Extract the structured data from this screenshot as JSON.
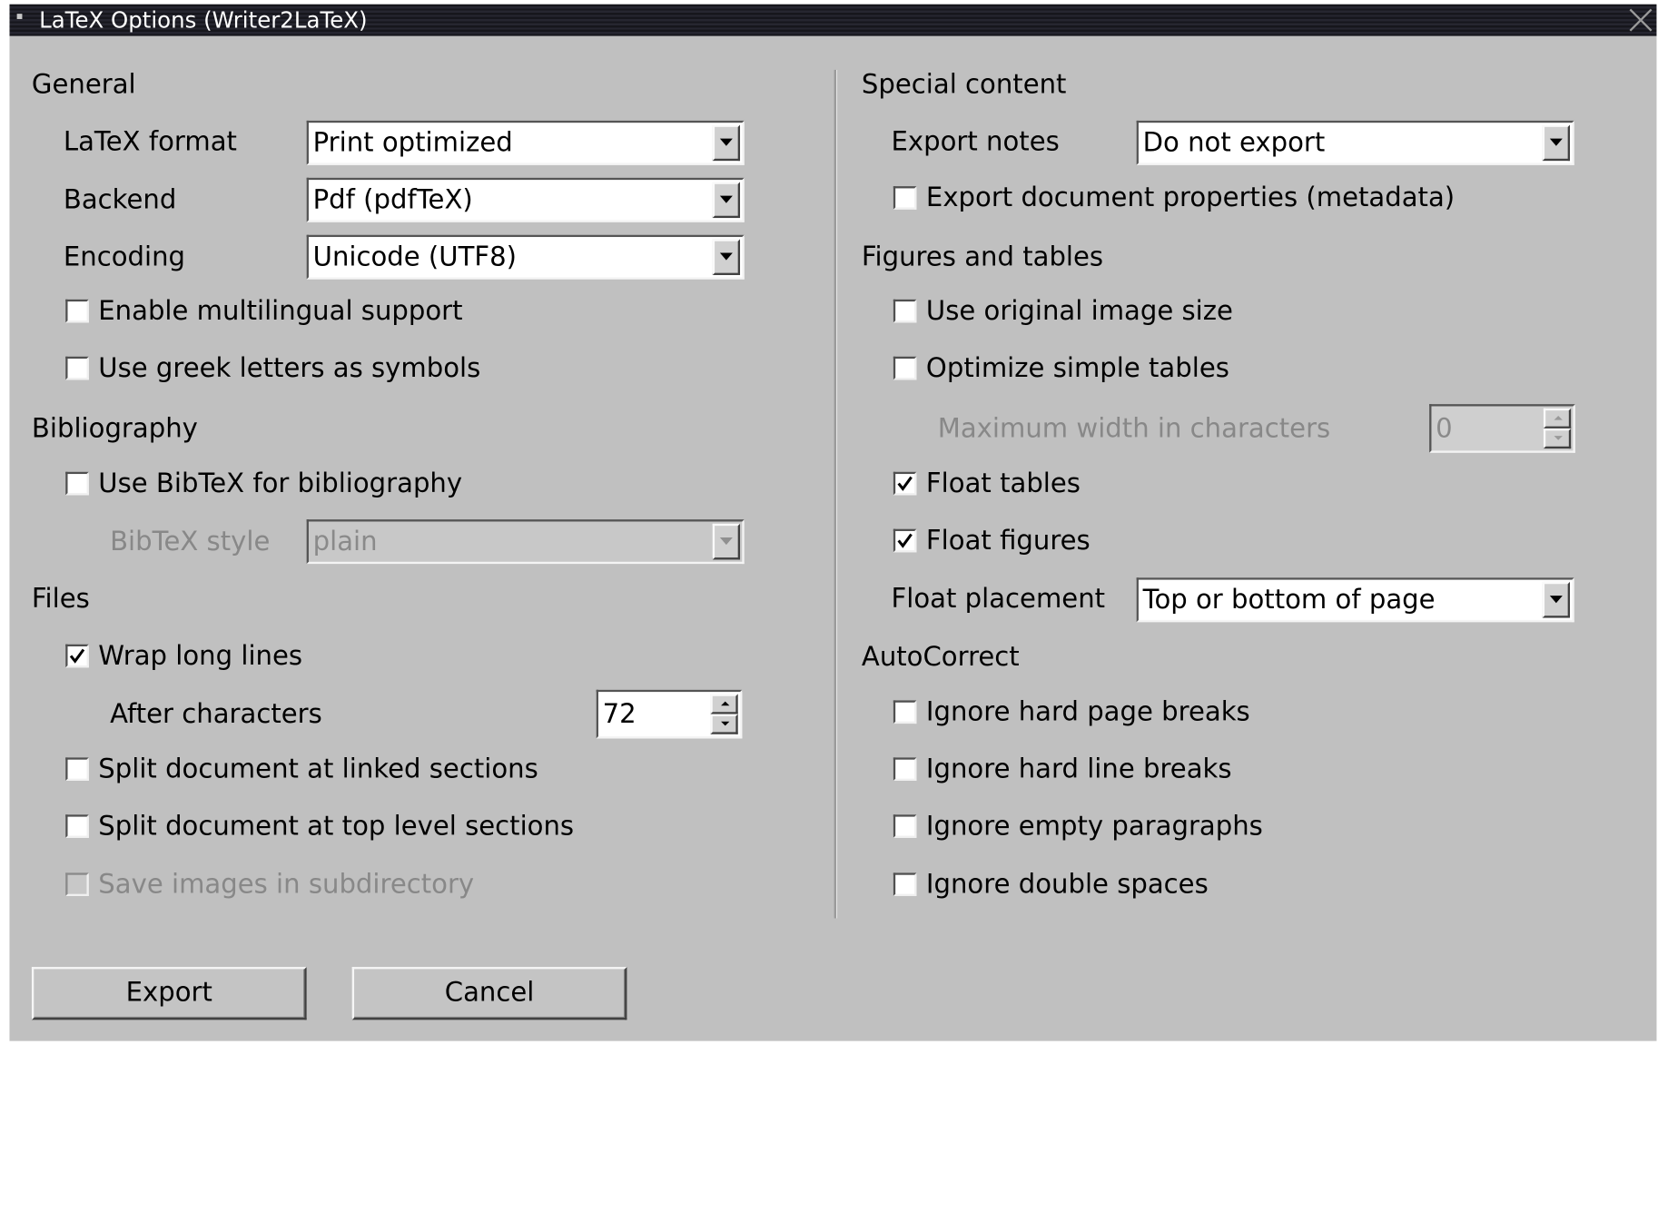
{
  "window": {
    "title": "LaTeX Options (Writer2LaTeX)"
  },
  "general": {
    "heading": "General",
    "latex_format": {
      "label": "LaTeX format",
      "value": "Print optimized"
    },
    "backend": {
      "label": "Backend",
      "value": "Pdf (pdfTeX)"
    },
    "encoding": {
      "label": "Encoding",
      "value": "Unicode (UTF8)"
    },
    "multilingual": {
      "label": "Enable multilingual support",
      "checked": false
    },
    "greek": {
      "label": "Use greek letters as symbols",
      "checked": false
    }
  },
  "bibliography": {
    "heading": "Bibliography",
    "use_bibtex": {
      "label": "Use BibTeX for bibliography",
      "checked": false
    },
    "bibtex_style": {
      "label": "BibTeX style",
      "value": "plain",
      "enabled": false
    }
  },
  "files": {
    "heading": "Files",
    "wrap_lines": {
      "label": "Wrap long lines",
      "checked": true
    },
    "after_chars": {
      "label": "After characters",
      "value": "72"
    },
    "split_linked": {
      "label": "Split document at linked sections",
      "checked": false
    },
    "split_top": {
      "label": "Split document at top level sections",
      "checked": false
    },
    "save_images": {
      "label": "Save images in subdirectory",
      "checked": false,
      "enabled": false
    }
  },
  "special_content": {
    "heading": "Special content",
    "export_notes": {
      "label": "Export notes",
      "value": "Do not export"
    },
    "export_metadata": {
      "label": "Export document properties (metadata)",
      "checked": false
    }
  },
  "figures_tables": {
    "heading": "Figures and tables",
    "original_image_size": {
      "label": "Use original image size",
      "checked": false
    },
    "optimize_tables": {
      "label": "Optimize simple tables",
      "checked": false
    },
    "max_width": {
      "label": "Maximum width in characters",
      "value": "0",
      "enabled": false
    },
    "float_tables": {
      "label": "Float tables",
      "checked": true
    },
    "float_figures": {
      "label": "Float figures",
      "checked": true
    },
    "float_placement": {
      "label": "Float placement",
      "value": "Top or bottom of page"
    }
  },
  "autocorrect": {
    "heading": "AutoCorrect",
    "ignore_page_breaks": {
      "label": "Ignore hard page breaks",
      "checked": false
    },
    "ignore_line_breaks": {
      "label": "Ignore hard line breaks",
      "checked": false
    },
    "ignore_empty_paragraphs": {
      "label": "Ignore empty paragraphs",
      "checked": false
    },
    "ignore_double_spaces": {
      "label": "Ignore double spaces",
      "checked": false
    }
  },
  "buttons": {
    "export": "Export",
    "cancel": "Cancel"
  },
  "colors": {
    "dialog_bg": "#c0c0c0",
    "titlebar_bg": "#1c1c24",
    "disabled_text": "#888888"
  },
  "icons": {
    "titlebar_menu": "window-menu-icon",
    "titlebar_close": "close-icon",
    "check_mark": "checkmark-icon"
  }
}
